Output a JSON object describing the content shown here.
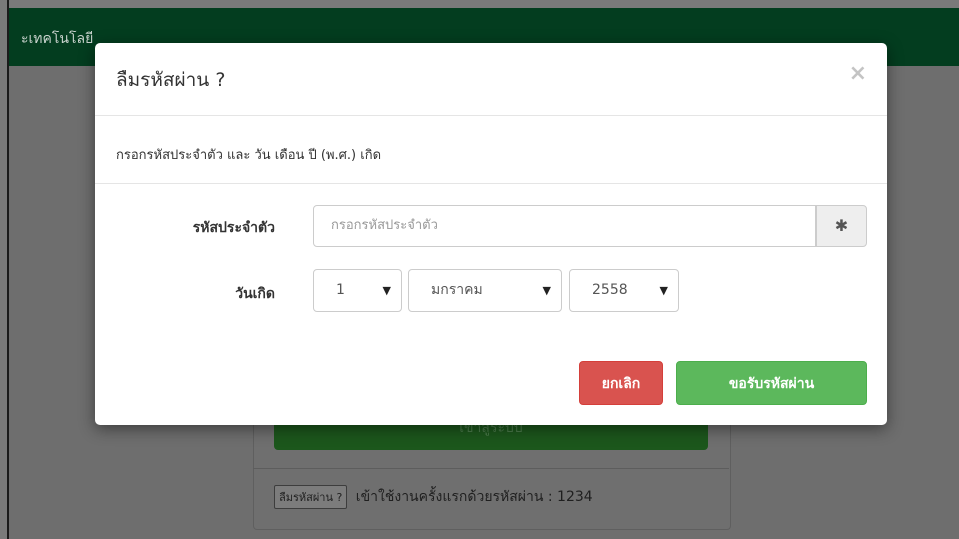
{
  "background": {
    "brand": "ะเทคโนโลยี",
    "login_button": "เข้าสู่ระบบ",
    "footer": {
      "forgot_button": "ลืมรหัสผ่าน ?",
      "hint": "เข้าใช้งานครั้งแรกด้วยรหัสผ่าน : 1234"
    }
  },
  "modal": {
    "title": "ลืมรหัสผ่าน ?",
    "close": "×",
    "description": "กรอกรหัสประจำตัว และ วัน เดือน ปี (พ.ศ.) เกิด",
    "id_label": "รหัสประจำตัว",
    "id_placeholder": "กรอกรหัสประจำตัว",
    "id_addon": "✱",
    "dob_label": "วันเกิด",
    "day_value": "1",
    "month_value": "มกราคม",
    "year_value": "2558",
    "dropdown_caret": "▼",
    "cancel_button": "ยกเลิก",
    "submit_button": "ขอรับรหัสผ่าน"
  },
  "colors": {
    "navbar": "#033d1f",
    "cancel": "#d9534f",
    "submit": "#5cb85c"
  }
}
